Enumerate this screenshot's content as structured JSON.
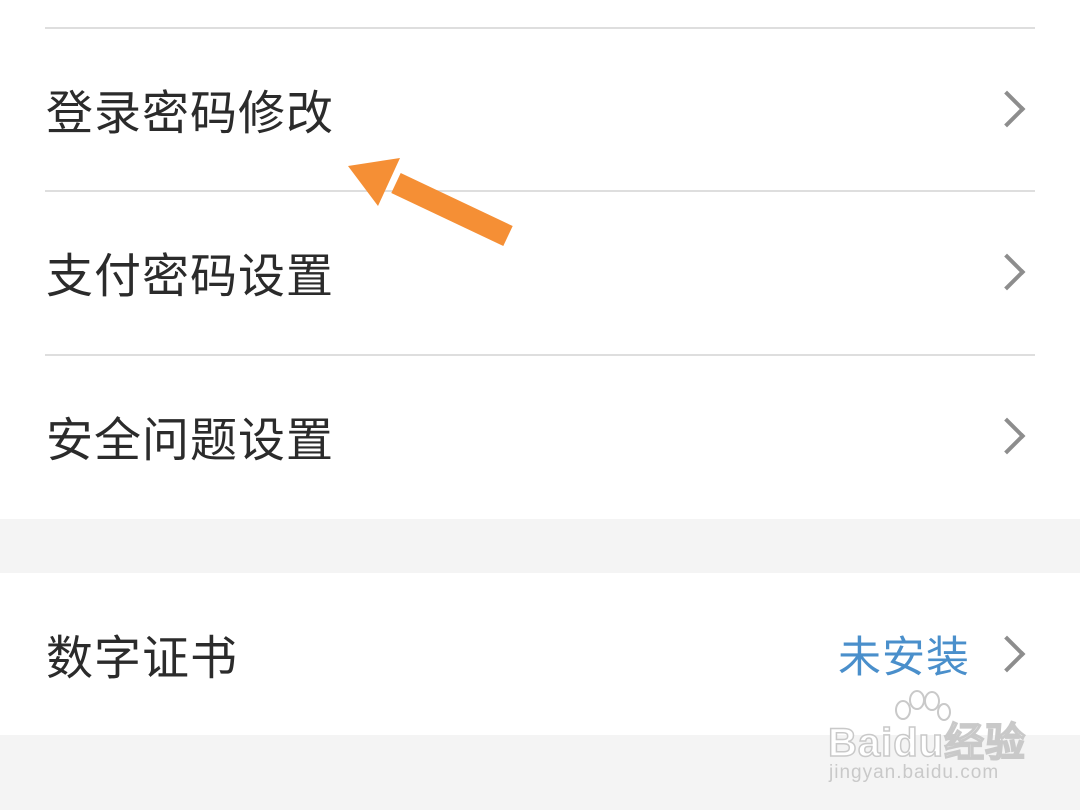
{
  "security_settings": {
    "items": [
      {
        "label": "登录密码修改"
      },
      {
        "label": "支付密码设置"
      },
      {
        "label": "安全问题设置"
      }
    ]
  },
  "certificate": {
    "label": "数字证书",
    "status": "未安装",
    "status_color": "#4a8fcb"
  },
  "annotation": {
    "arrow_color": "#f58f35"
  },
  "watermark": {
    "logo_text": "Baidu经验",
    "url": "jingyan.baidu.com"
  },
  "icons": {
    "row_chevron": "chevron-right-icon",
    "annotation": "orange-arrow-icon"
  }
}
